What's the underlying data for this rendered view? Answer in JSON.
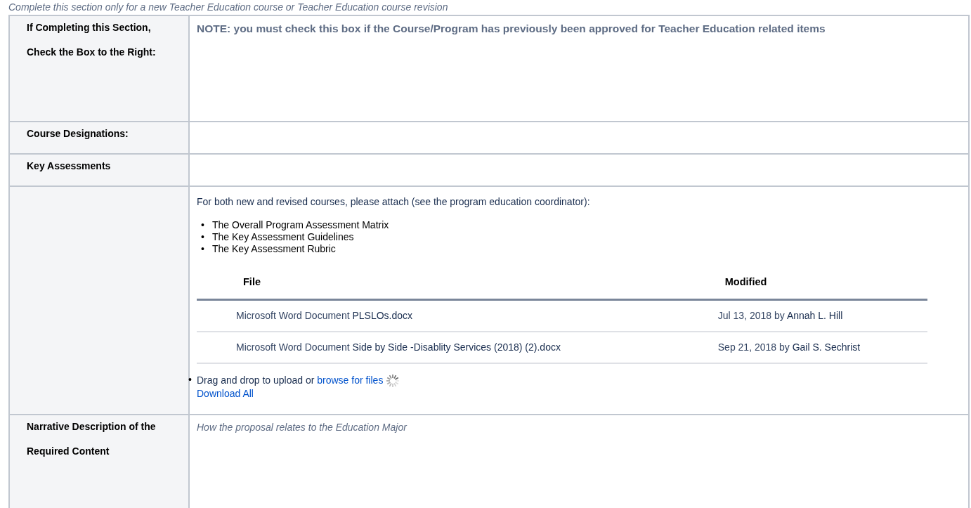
{
  "intro_note": "Complete this section only for a new Teacher Education course or Teacher Education course revision",
  "rows": [
    {
      "kind": "note",
      "label": [
        "If Completing this Section,",
        "Check the Box to the Right:"
      ],
      "text": "NOTE: you must check this box if the Course/Program has previously been approved for Teacher Education related items"
    },
    {
      "kind": "empty",
      "label": [
        "Course Designations:"
      ]
    },
    {
      "kind": "empty",
      "label": [
        "Key Assessments"
      ]
    },
    {
      "kind": "attachments",
      "label": [],
      "text": "For both new and revised courses, please attach (see the program education coordinator):",
      "bullet_marker": "•",
      "bullets": [
        "The Overall Program Assessment Matrix",
        "The Key Assessment Guidelines",
        "The Key Assessment Rubric"
      ],
      "columns": [
        "File",
        "Modified"
      ],
      "files": [
        {
          "type": "Microsoft Word Document",
          "name": "PLSLOs.docx",
          "date": "Jul 13, 2018 by",
          "author": "Annah L. Hill"
        },
        {
          "type": "Microsoft Word Document",
          "name": "Side by Side -Disablity Services (2018) (2).docx",
          "date": "Sep 21, 2018 by",
          "author": "Gail S. Sechrist"
        }
      ],
      "upload": {
        "text": "Drag and drop to upload or",
        "link": "browse for files"
      },
      "download_all": "Download All"
    },
    {
      "kind": "placeholder",
      "label": [
        "Narrative Description of the",
        "Required Content"
      ],
      "text": "How the proposal relates to the Education Major"
    }
  ]
}
